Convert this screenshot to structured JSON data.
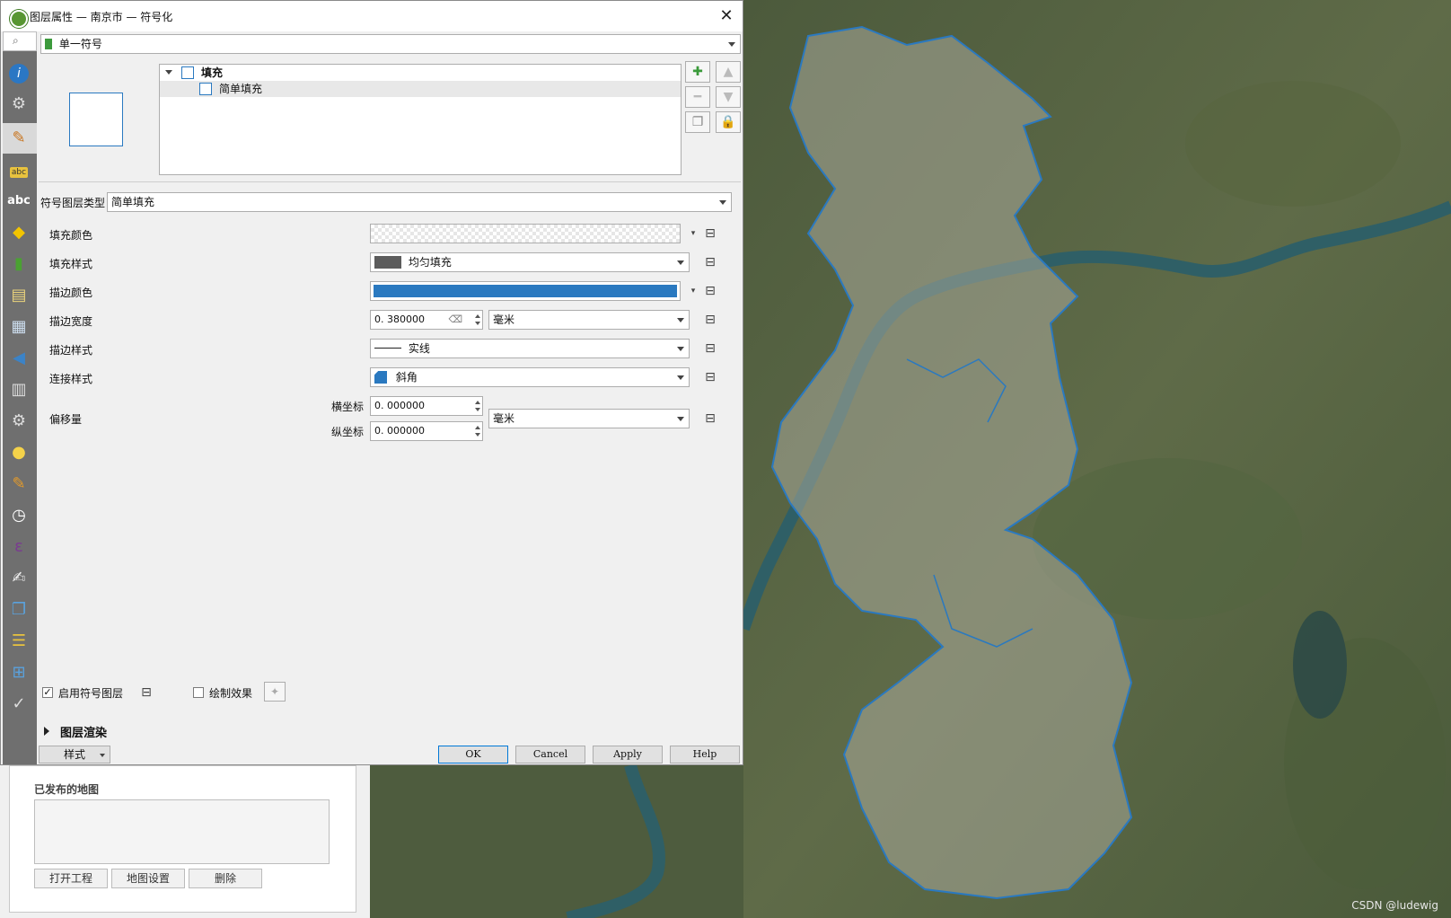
{
  "window": {
    "title": "图层属性 — 南京市 — 符号化"
  },
  "renderer": {
    "selected": "单一符号"
  },
  "symbol_tree": {
    "root_label": "填充",
    "child_label": "简单填充"
  },
  "symbol_layer_type": {
    "label": "符号图层类型",
    "value": "简单填充"
  },
  "props": {
    "fill_color_label": "填充颜色",
    "fill_style_label": "填充样式",
    "fill_style_value": "均匀填充",
    "stroke_color_label": "描边颜色",
    "stroke_color": "#2a79c0",
    "stroke_width_label": "描边宽度",
    "stroke_width_value": "0. 380000",
    "stroke_width_unit": "毫米",
    "stroke_style_label": "描边样式",
    "stroke_style_value": "实线",
    "join_style_label": "连接样式",
    "join_style_value": "斜角",
    "offset_label": "偏移量",
    "offset_x_label": "横坐标",
    "offset_x_value": "0. 000000",
    "offset_y_label": "纵坐标",
    "offset_y_value": "0. 000000",
    "offset_unit": "毫米"
  },
  "footer": {
    "enable_symbol_layer_label": "启用符号图层",
    "enable_symbol_layer_checked": true,
    "draw_effects_label": "绘制效果",
    "draw_effects_checked": false,
    "layer_rendering_label": "图层渲染",
    "style_button": "样式",
    "ok": "OK",
    "cancel": "Cancel",
    "apply": "Apply",
    "help": "Help"
  },
  "background_panel": {
    "title": "已发布的地图",
    "buttons": [
      "打开工程",
      "地图设置",
      "删除"
    ]
  },
  "map": {
    "watermark": "CSDN @ludewig",
    "boundary_color": "#2a79c0"
  }
}
